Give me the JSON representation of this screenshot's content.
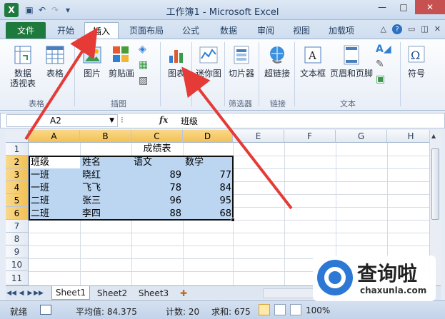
{
  "window": {
    "title": "工作簿1 - Microsoft Excel",
    "logo": "X",
    "controls": {
      "minimize": "—",
      "maximize": "□",
      "close": "✕"
    }
  },
  "quick_access": {
    "save_icon": "save-icon",
    "undo_icon": "undo-icon",
    "redo_icon": "redo-icon",
    "customize_icon": "dropdown-icon"
  },
  "ribbon_tabs": [
    "文件",
    "开始",
    "插入",
    "页面布局",
    "公式",
    "数据",
    "审阅",
    "视图",
    "加载项"
  ],
  "active_tab": "插入",
  "ribbon": {
    "buttons": [
      {
        "label": "数据\n透视表",
        "icon": "pivot-table-icon"
      },
      {
        "label": "表格",
        "icon": "table-icon"
      },
      {
        "label": "图片",
        "icon": "picture-icon"
      },
      {
        "label": "剪贴画",
        "icon": "clipart-icon"
      },
      {
        "label": "图表",
        "icon": "chart-icon"
      },
      {
        "label": "迷你图",
        "icon": "sparkline-icon"
      },
      {
        "label": "切片器",
        "icon": "slicer-icon"
      },
      {
        "label": "超链接",
        "icon": "hyperlink-icon"
      },
      {
        "label": "文本框",
        "icon": "textbox-icon"
      },
      {
        "label": "页眉和页脚",
        "icon": "header-footer-icon"
      },
      {
        "label": "符号",
        "icon": "symbol-icon"
      }
    ],
    "groups": [
      "表格",
      "插图",
      "筛选器",
      "链接",
      "文本"
    ]
  },
  "formula_bar": {
    "name_box": "A2",
    "fx": "fx",
    "content": "班级"
  },
  "sheet": {
    "columns": [
      "A",
      "B",
      "C",
      "D",
      "E",
      "F",
      "G",
      "H"
    ],
    "rows": [
      "1",
      "2",
      "3",
      "4",
      "5",
      "6",
      "7",
      "8",
      "9",
      "10",
      "11"
    ],
    "title": "成绩表",
    "header": [
      "班级",
      "姓名",
      "语文",
      "数学"
    ],
    "data": [
      [
        "一班",
        "晓红",
        "89",
        "77"
      ],
      [
        "一班",
        "飞飞",
        "78",
        "84"
      ],
      [
        "二班",
        "张三",
        "96",
        "95"
      ],
      [
        "二班",
        "李四",
        "88",
        "68"
      ]
    ]
  },
  "sheet_tabs": [
    "Sheet1",
    "Sheet2",
    "Sheet3"
  ],
  "status": {
    "ready": "就绪",
    "average": "平均值: 84.375",
    "count": "计数: 20",
    "sum": "求和: 675",
    "zoom": "100%"
  },
  "watermark": {
    "text": "查询啦",
    "url": "chaxunla.com"
  }
}
